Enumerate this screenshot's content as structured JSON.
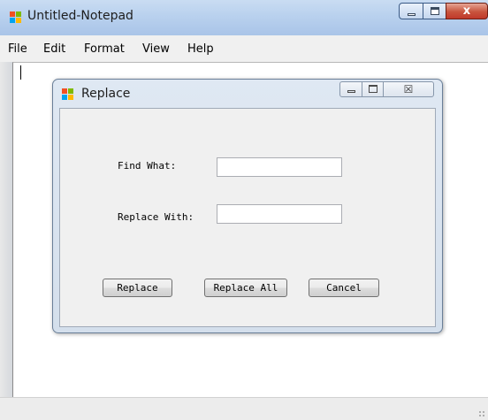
{
  "window": {
    "title": "Untitled-Notepad",
    "icon": "app-window-icon",
    "controls": {
      "minimize": "minimize-icon",
      "maximize": "maximize-icon",
      "close": "close-icon",
      "close_glyph": "x"
    }
  },
  "menu": {
    "items": [
      {
        "label": "File"
      },
      {
        "label": "Edit"
      },
      {
        "label": "Format"
      },
      {
        "label": "View"
      },
      {
        "label": "Help"
      }
    ]
  },
  "editor": {
    "value": ""
  },
  "dialog": {
    "title": "Replace",
    "close_glyph": "☒",
    "find_label": "Find What:",
    "find_value": "",
    "replace_label": "Replace With:",
    "replace_value": "",
    "buttons": {
      "replace": "Replace",
      "replace_all": "Replace All",
      "cancel": "Cancel"
    }
  },
  "colors": {
    "titlebar": "#b9d1ee",
    "close_button": "#c8543d",
    "dialog_frame": "#d4dfec",
    "client_bg": "#f0f0f0"
  }
}
